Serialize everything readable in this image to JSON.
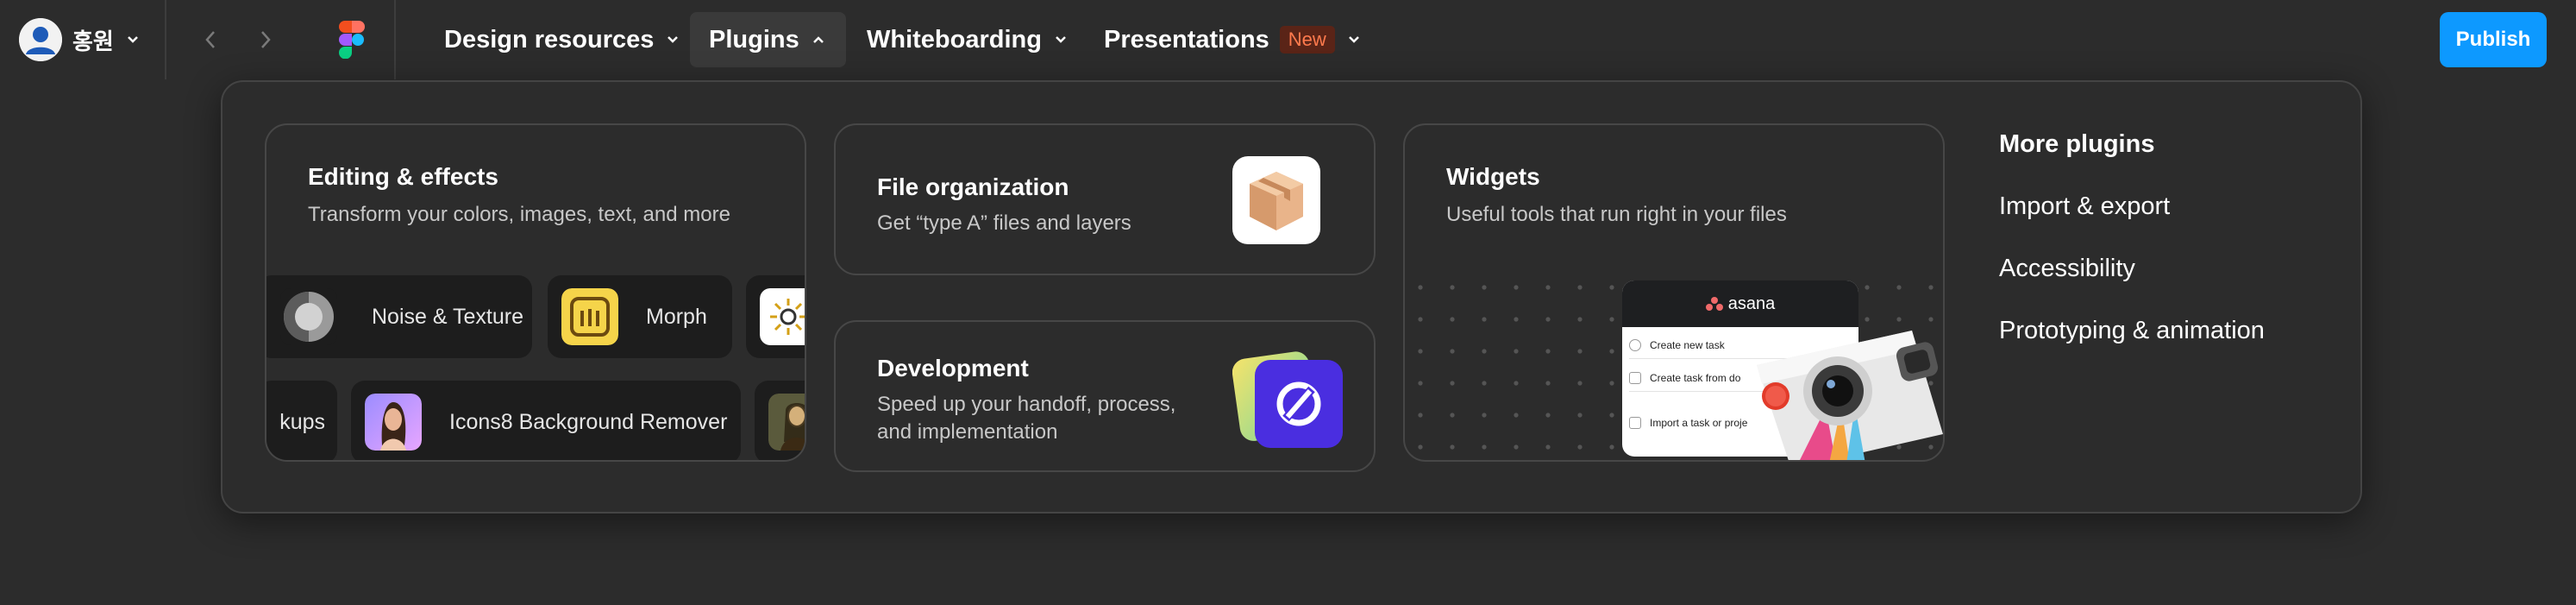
{
  "topbar": {
    "user_name": "홍원",
    "menus": [
      {
        "label": "Design resources"
      },
      {
        "label": "Plugins"
      },
      {
        "label": "Whiteboarding"
      },
      {
        "label": "Presentations",
        "badge": "New"
      }
    ],
    "publish_label": "Publish"
  },
  "panel": {
    "editing": {
      "title": "Editing & effects",
      "desc": "Transform your colors, images, text, and more",
      "chips_row1": [
        {
          "label": "Noise & Texture"
        },
        {
          "label": "Morph"
        },
        {
          "label": ""
        }
      ],
      "chips_row2": [
        {
          "label": "kups"
        },
        {
          "label": "Icons8 Background Remover"
        },
        {
          "label": ""
        }
      ]
    },
    "file_org": {
      "title": "File organization",
      "desc": "Get “type A” files and layers"
    },
    "development": {
      "title": "Development",
      "desc_line1": "Speed up your handoff, process,",
      "desc_line2": "and implementation"
    },
    "widgets": {
      "title": "Widgets",
      "desc": "Useful tools that run right in your files",
      "asana": {
        "brand": "asana",
        "items": [
          "Create new task",
          "Create task from do",
          "Import a task or proje"
        ]
      }
    },
    "more_plugins": {
      "heading": "More plugins",
      "links": [
        "Import & export",
        "Accessibility",
        "Prototyping & animation"
      ]
    }
  },
  "colors": {
    "background": "#2c2c2c",
    "accent": "#0d99ff",
    "badge_text": "#ff7a4d",
    "badge_bg": "#5a2417",
    "card_border": "#474747"
  }
}
